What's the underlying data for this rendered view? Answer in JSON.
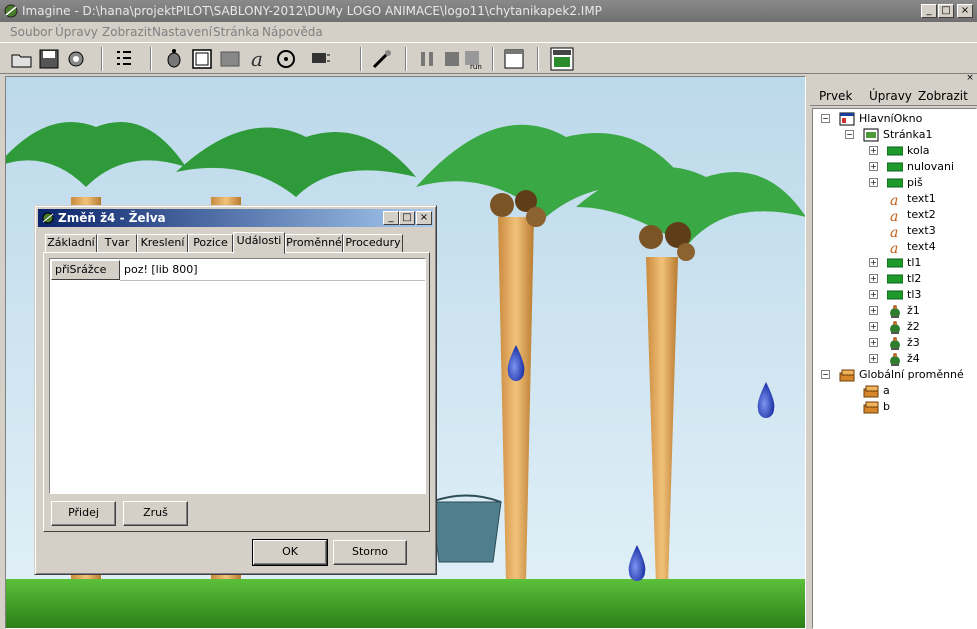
{
  "window": {
    "title": "Imagine - D:\\hana\\projektPILOT\\SABLONY-2012\\DUMy LOGO ANIMACE\\logo11\\chytanikapek2.IMP",
    "minimize": "_",
    "maximize": "□",
    "close": "×"
  },
  "menubar": [
    "Soubor",
    "Úpravy",
    "Zobrazit",
    "Nastavení",
    "Stránka",
    "Nápověda"
  ],
  "toolbar_icons": [
    "open-icon",
    "save-icon",
    "settings-icon",
    "list-icon",
    "turtle-icon",
    "rectangle-icon",
    "filled-rect-icon",
    "text-icon",
    "media-icon",
    "effects-icon",
    "tools-icon",
    "pause-icon",
    "stop-icon",
    "run-icon",
    "window-icon",
    "page-view-icon"
  ],
  "panel": {
    "menu": [
      "Prvek",
      "Úpravy",
      "Zobrazit"
    ],
    "close": "×",
    "tree": [
      {
        "label": "HlavníOkno",
        "icon": "window-icon",
        "level": 0,
        "expander": "−"
      },
      {
        "label": "Stránka1",
        "icon": "page-icon",
        "level": 1,
        "expander": "−"
      },
      {
        "label": "kola",
        "icon": "button-icon",
        "level": 2,
        "expander": "+"
      },
      {
        "label": "nulovani",
        "icon": "button-icon",
        "level": 2,
        "expander": "+"
      },
      {
        "label": "piš",
        "icon": "button-icon",
        "level": 2,
        "expander": "+"
      },
      {
        "label": "text1",
        "icon": "text-icon",
        "level": 2,
        "expander": ""
      },
      {
        "label": "text2",
        "icon": "text-icon",
        "level": 2,
        "expander": ""
      },
      {
        "label": "text3",
        "icon": "text-icon",
        "level": 2,
        "expander": ""
      },
      {
        "label": "text4",
        "icon": "text-icon",
        "level": 2,
        "expander": ""
      },
      {
        "label": "tl1",
        "icon": "button-icon",
        "level": 2,
        "expander": "+"
      },
      {
        "label": "tl2",
        "icon": "button-icon",
        "level": 2,
        "expander": "+"
      },
      {
        "label": "tl3",
        "icon": "button-icon",
        "level": 2,
        "expander": "+"
      },
      {
        "label": "ž1",
        "icon": "turtle-icon",
        "level": 2,
        "expander": "+"
      },
      {
        "label": "ž2",
        "icon": "turtle-icon",
        "level": 2,
        "expander": "+"
      },
      {
        "label": "ž3",
        "icon": "turtle-icon",
        "level": 2,
        "expander": "+"
      },
      {
        "label": "ž4",
        "icon": "turtle-icon",
        "level": 2,
        "expander": "+"
      },
      {
        "label": "Globální proměnné",
        "icon": "variables-icon",
        "level": 0,
        "expander": "−"
      },
      {
        "label": "a",
        "icon": "variable-icon",
        "level": 1,
        "expander": ""
      },
      {
        "label": "b",
        "icon": "variable-icon",
        "level": 1,
        "expander": ""
      }
    ]
  },
  "dialog": {
    "title": "Změň ž4  - Želva",
    "tabs": [
      "Základní",
      "Tvar",
      "Kreslení",
      "Pozice",
      "Události",
      "Proměnné",
      "Procedury"
    ],
    "active_tab": "Události",
    "event_key": "přiSrážce",
    "event_value": "poz! [lib 800]",
    "add_button": "Přidej",
    "remove_button": "Zruš",
    "ok_button": "OK",
    "cancel_button": "Storno"
  },
  "colors": {
    "titlebar": "#777777",
    "dialog_title_start": "#0a246a",
    "dialog_title_end": "#a6caf0",
    "sky": "#cfe6f3",
    "grass": "#3fa323",
    "drop": "#2f49c9"
  }
}
